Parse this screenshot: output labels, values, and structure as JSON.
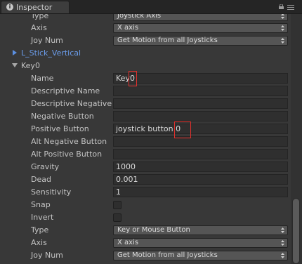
{
  "tab": {
    "title": "Inspector",
    "icon": "info-icon"
  },
  "toolbar": {
    "lock_icon": "lock-icon",
    "menu_icon": "context-menu-icon"
  },
  "top_section": {
    "type_label": "Type",
    "type_value": "Joystick Axis",
    "axis_label": "Axis",
    "axis_value": "X axis",
    "joynum_label": "Joy Num",
    "joynum_value": "Get Motion from all Joysticks"
  },
  "collapsed_item": {
    "label": "L_Stick_Vertical"
  },
  "expanded_item": {
    "label": "Key0",
    "fields": {
      "name_label": "Name",
      "name_value": "Key0",
      "descriptive_name_label": "Descriptive Name",
      "descriptive_name_value": "",
      "descriptive_negative_label": "Descriptive Negative",
      "descriptive_negative_value": "",
      "negative_button_label": "Negative Button",
      "negative_button_value": "",
      "positive_button_label": "Positive Button",
      "positive_button_value": "joystick button 0",
      "alt_negative_button_label": "Alt Negative Button",
      "alt_negative_button_value": "",
      "alt_positive_button_label": "Alt Positive Button",
      "alt_positive_button_value": "",
      "gravity_label": "Gravity",
      "gravity_value": "1000",
      "dead_label": "Dead",
      "dead_value": "0.001",
      "sensitivity_label": "Sensitivity",
      "sensitivity_value": "1",
      "snap_label": "Snap",
      "snap_checked": false,
      "invert_label": "Invert",
      "invert_checked": false,
      "type_label": "Type",
      "type_value": "Key or Mouse Button",
      "axis_label": "Axis",
      "axis_value": "X axis",
      "joynum_label": "Joy Num",
      "joynum_value": "Get Motion from all Joysticks"
    }
  },
  "colors": {
    "background": "#383838",
    "link_blue": "#6a9be8",
    "highlight_red": "#e0302c"
  }
}
